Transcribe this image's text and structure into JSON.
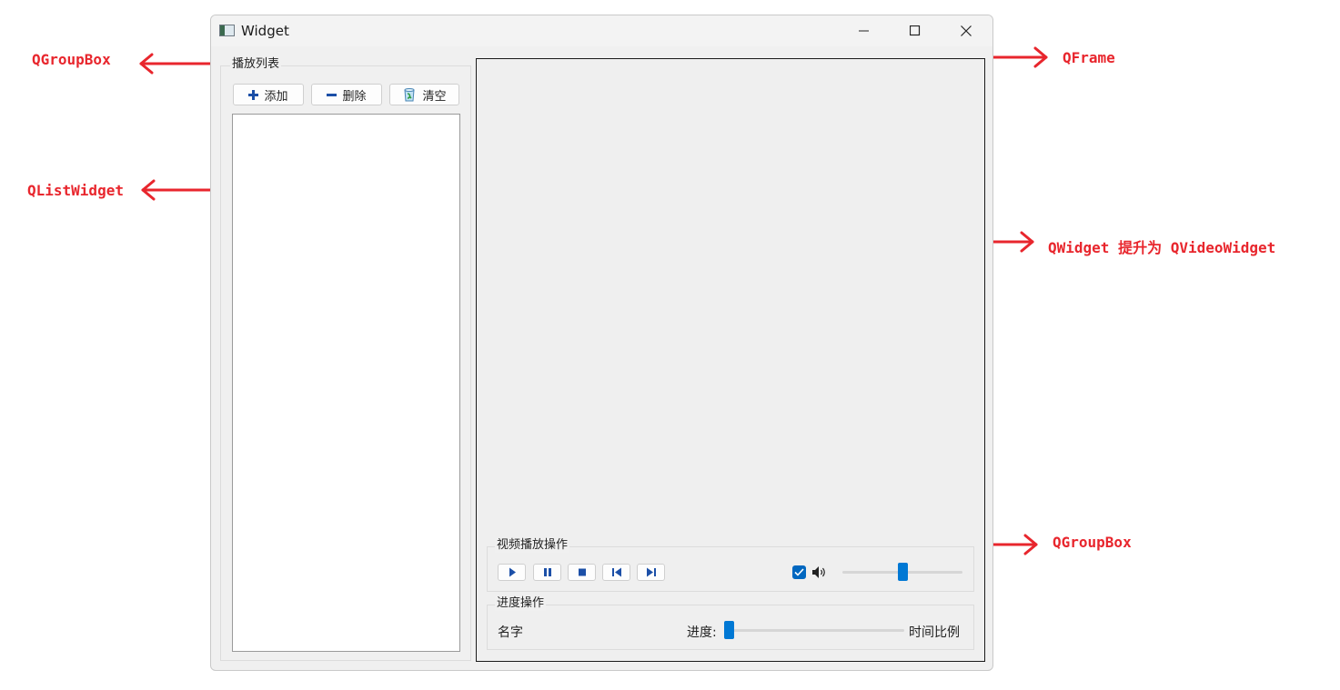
{
  "window": {
    "title": "Widget"
  },
  "playlist": {
    "group_title": "播放列表",
    "add_label": "添加",
    "delete_label": "删除",
    "clear_label": "清空"
  },
  "video_controls": {
    "group_title": "视频播放操作",
    "mute_checked": true,
    "volume_level": 0.5
  },
  "progress": {
    "group_title": "进度操作",
    "name_label": "名字",
    "progress_label": "进度:",
    "time_label": "时间比例",
    "value": 0.0
  },
  "annotations": {
    "groupbox_top": "QGroupBox",
    "listwidget": "QListWidget",
    "frame": "QFrame",
    "videowidget": "QWidget 提升为 QVideoWidget",
    "groupbox_bottom": "QGroupBox"
  },
  "colors": {
    "annotation": "#e8262d",
    "accent": "#0078d4",
    "icon_blue": "#1b4fa7"
  },
  "icons": [
    "app-icon",
    "minimize-icon",
    "maximize-icon",
    "close-icon",
    "plus-icon",
    "minus-icon",
    "recycle-bin-icon",
    "play-icon",
    "pause-icon",
    "stop-icon",
    "skip-back-icon",
    "skip-forward-icon",
    "check-icon",
    "speaker-icon"
  ]
}
